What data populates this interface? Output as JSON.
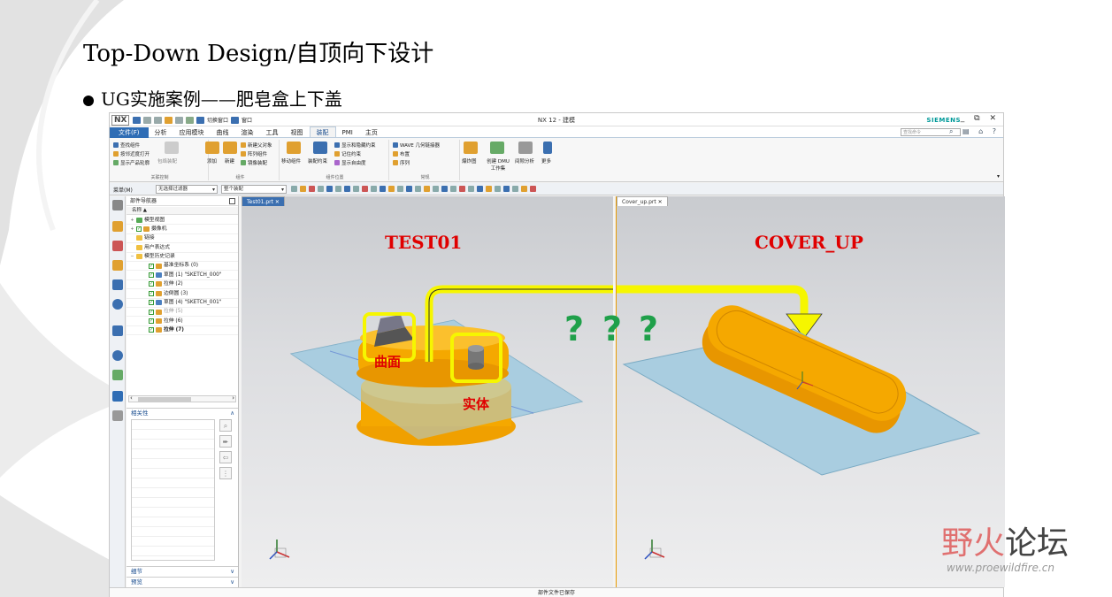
{
  "slide": {
    "title": "Top-Down Design/自顶向下设计",
    "bullet": "UG实施案例——肥皂盒上下盖"
  },
  "app": {
    "logo": "NX",
    "window_title": "NX 12 - 建模",
    "brand": "SIEMENS",
    "brand_color": "#009999",
    "accent_color": "#2f6db5",
    "window_controls": "_ ⧉ ✕",
    "quick_access": [
      "save-icon",
      "undo-icon",
      "redo-icon",
      "cut-icon",
      "copy-icon",
      "paste-icon",
      "switch-window-icon",
      "window-icon"
    ],
    "quick_access_texts": [
      "切换窗口",
      "窗口"
    ]
  },
  "menus": [
    "文件(F)",
    "分析",
    "应用模块",
    "曲线",
    "渲染",
    "工具",
    "视图",
    "装配",
    "PMI",
    "主页"
  ],
  "active_menu": "装配",
  "search_placeholder": "查找命令",
  "ribbon": {
    "small_items_1": [
      "查找组件",
      "按邻近度打开",
      "显示产品轮廓"
    ],
    "item_1_big": "包络装配",
    "group_1": "关联控制",
    "add": "添加",
    "new": "新建",
    "small_items_2": [
      "新建父对象",
      "阵列组件",
      "镜像装配"
    ],
    "group_2": "组件",
    "move": "移动组件",
    "constraint": "装配约束",
    "small_items_3": [
      "显示和隐藏约束",
      "记住约束",
      "显示自由度"
    ],
    "group_3": "组件位置",
    "small_items_4": [
      "WAVE 几何链接器",
      "布置",
      "序列"
    ],
    "group_4": "常规",
    "explode": "爆炸图",
    "dmu": "创建 DMU 工作集",
    "interference": "间隙分析",
    "more": "更多"
  },
  "selection_bar": {
    "menu": "菜单(M)",
    "filter": "无选择过滤器",
    "scope": "整个装配"
  },
  "navigator": {
    "title": "部件导航器",
    "column": "名称",
    "items": [
      {
        "label": "模型视图",
        "expand": "+",
        "type": "view"
      },
      {
        "label": "摄像机",
        "expand": "+",
        "type": "cam"
      },
      {
        "label": "链接",
        "expand": "",
        "type": "folder"
      },
      {
        "label": "用户表达式",
        "expand": "",
        "type": "folder"
      },
      {
        "label": "模型历史记录",
        "expand": "−",
        "type": "folder"
      },
      {
        "label": "基准坐标系 (0)",
        "expand": "",
        "type": "feat"
      },
      {
        "label": "草图 (1) \"SKETCH_000\"",
        "expand": "",
        "type": "sketch"
      },
      {
        "label": "拉伸 (2)",
        "expand": "",
        "type": "feat"
      },
      {
        "label": "边倒圆 (3)",
        "expand": "",
        "type": "feat"
      },
      {
        "label": "草图 (4) \"SKETCH_001\"",
        "expand": "",
        "type": "sketch"
      },
      {
        "label": "拉伸 (5)",
        "expand": "",
        "type": "feat",
        "dim": true
      },
      {
        "label": "拉伸 (6)",
        "expand": "",
        "type": "feat"
      },
      {
        "label": "拉伸 (7)",
        "expand": "",
        "type": "feat",
        "bold": true
      }
    ],
    "dependency": "相关性",
    "details": "细节",
    "preview": "预览"
  },
  "viewports": {
    "left_tab": "Test01.prt",
    "right_tab": "Cover_up.prt",
    "left_label": "TEST01",
    "right_label": "COVER_UP",
    "surface_label": "曲面",
    "solid_label": "实体",
    "question_marks": [
      "?",
      "?",
      "?"
    ],
    "highlight_color": "#f6f600",
    "part_color": "#f5a800",
    "plane_color": "#a9cde0"
  },
  "status": "部件文件已保存",
  "watermark": {
    "text": "野火",
    "text2": "论坛",
    "url": "www.proewildfire.cn"
  }
}
